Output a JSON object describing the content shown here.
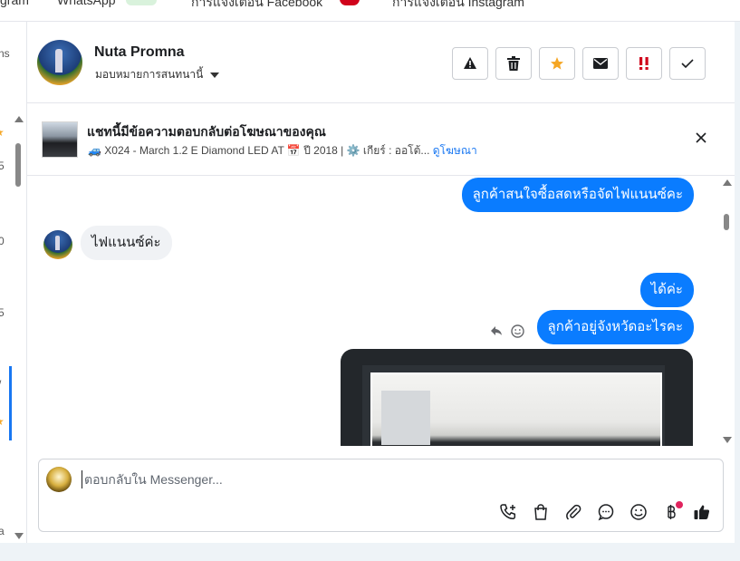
{
  "topbar": {
    "tabs": [
      "gram",
      "WhatsApp",
      "การแจ้งเตือน Facebook",
      "การแจ้งเตือน Instagram"
    ]
  },
  "sidebar": {
    "fragments": [
      "ns",
      "5",
      "0",
      "5",
      "/",
      "a"
    ]
  },
  "header": {
    "name": "Nuta Promna",
    "assign_label": "มอบหมายการสนทนานี้",
    "actions": [
      {
        "name": "report-button",
        "icon": "warning-icon"
      },
      {
        "name": "delete-button",
        "icon": "trash-icon"
      },
      {
        "name": "star-button",
        "icon": "star-icon"
      },
      {
        "name": "mark-unread-button",
        "icon": "envelope-icon"
      },
      {
        "name": "spam-button",
        "icon": "double-exclamation-icon"
      },
      {
        "name": "done-button",
        "icon": "check-icon"
      }
    ]
  },
  "ad_context": {
    "title": "แชทนี้มีข้อความตอบกลับต่อโฆษณาของคุณ",
    "subtitle": "🚙 X024 - March 1.2 E Diamond LED AT 📅 ปี 2018 | ⚙️ เกียร์ : ออโต้...",
    "link": "ดูโฆษณา"
  },
  "messages": [
    {
      "direction": "out",
      "text": "ลูกค้าสนใจซื้อสดหรือจัดไฟแนนซ์คะ"
    },
    {
      "direction": "in",
      "text": "ไฟแนนซ์ค่ะ"
    },
    {
      "direction": "out",
      "text": "ได้ค่ะ"
    },
    {
      "direction": "out",
      "text": "ลูกค้าอยู่จังหวัดอะไรคะ"
    },
    {
      "direction": "out",
      "type": "image"
    }
  ],
  "composer": {
    "placeholder": "ตอบกลับใน Messenger...",
    "tools": [
      "call-add-icon",
      "shopping-bag-icon",
      "paperclip-icon",
      "chat-bubble-icon",
      "emoji-icon",
      "baht-icon",
      "thumbs-up-icon"
    ]
  },
  "colors": {
    "accent": "#0a7cff",
    "star": "#f5a623",
    "danger": "#d0021b"
  }
}
